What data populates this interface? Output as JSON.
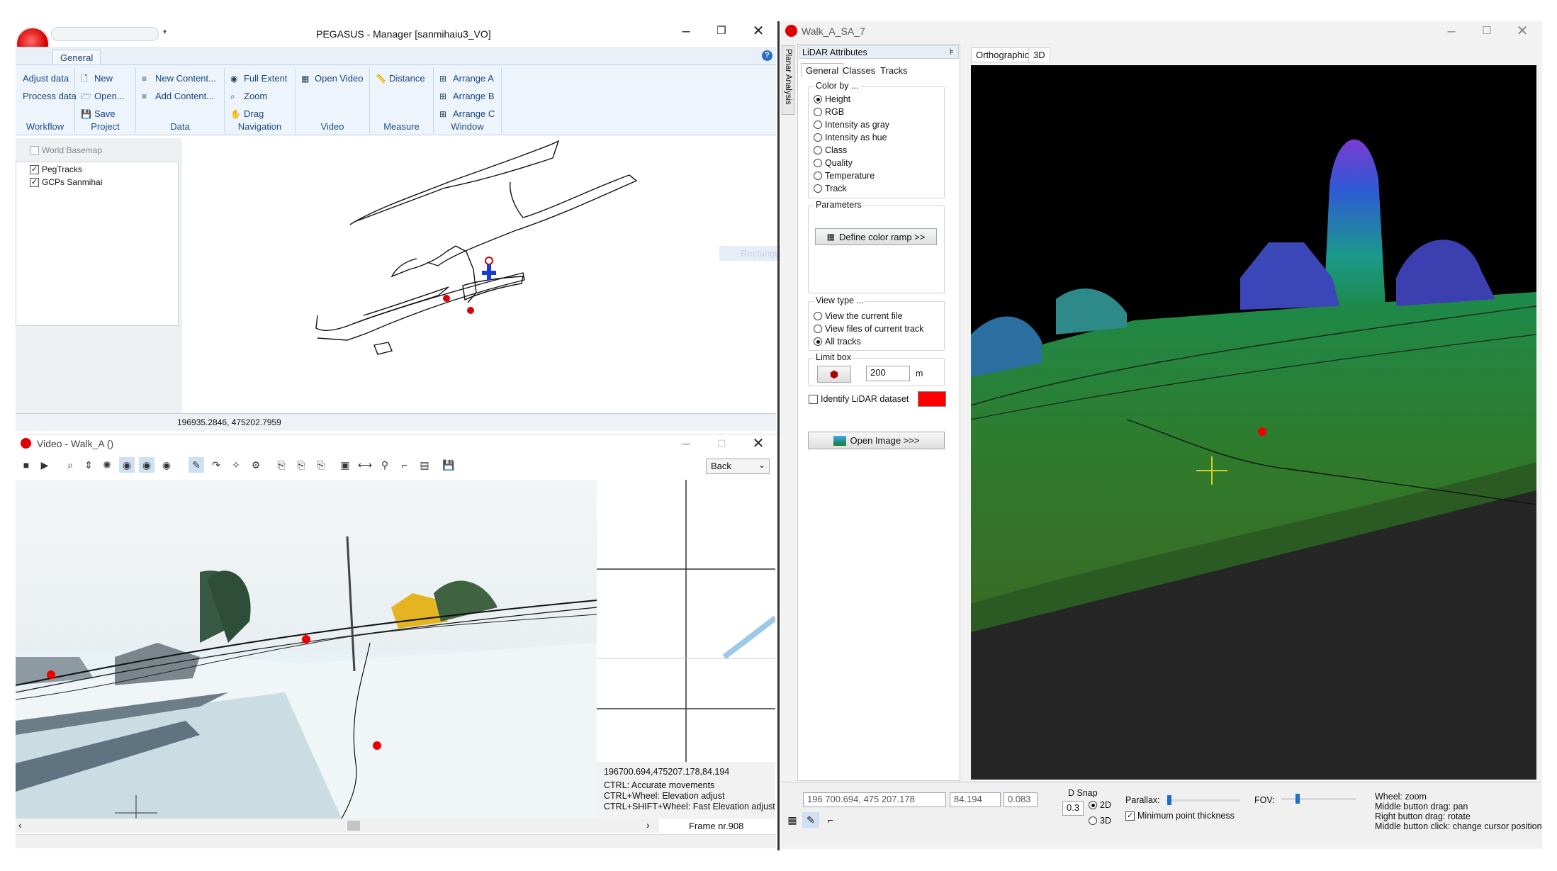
{
  "manager": {
    "title": "PEGASUS - Manager [sanmihaiu3_VO]",
    "tab_general": "General",
    "help": "?",
    "groups": {
      "workflow": {
        "label": "Workflow",
        "items": [
          "Adjust data",
          "Process data"
        ]
      },
      "project": {
        "label": "Project",
        "items": [
          "New",
          "Open...",
          "Save"
        ]
      },
      "data": {
        "label": "Data",
        "items": [
          "New Content...",
          "Add Content..."
        ]
      },
      "navigation": {
        "label": "Navigation",
        "items": [
          "Full Extent",
          "Zoom",
          "Drag"
        ]
      },
      "video": {
        "label": "Video",
        "items": [
          "Open Video"
        ]
      },
      "measure": {
        "label": "Measure",
        "items": [
          "Distance"
        ]
      },
      "window": {
        "label": "Window",
        "items": [
          "Arrange A",
          "Arrange B",
          "Arrange C"
        ]
      }
    },
    "layers": {
      "basemap": "World Basemap",
      "items": [
        "PegTracks",
        "GCPs Sanmihai"
      ]
    },
    "map_tooltip": "Rectangular Info",
    "status_coords": "196935.2846, 475202.7959"
  },
  "video": {
    "title": "Video - Walk_A ()",
    "direction_select": "Back",
    "coords": "196700.694,475207.178,84.194",
    "hints": [
      "CTRL: Accurate movements",
      "CTRL+Wheel: Elevation adjust",
      "CTRL+SHIFT+Wheel: Fast Elevation adjust"
    ],
    "frame": "Frame nr.908"
  },
  "lidar": {
    "title": "Walk_A_SA_7",
    "side_tab": "Planar Analysis",
    "panel_title": "LiDAR Attributes",
    "tabs": [
      "General",
      "Classes",
      "Tracks"
    ],
    "color_by_label": "Color by ...",
    "color_by": [
      "Height",
      "RGB",
      "Intensity as gray",
      "Intensity as hue",
      "Class",
      "Quality",
      "Temperature",
      "Track"
    ],
    "color_by_selected": "Height",
    "parameters_label": "Parameters",
    "define_ramp": "Define color ramp >>",
    "view_type_label": "View type ...",
    "view_types": [
      "View the current file",
      "View files of current track",
      "All tracks"
    ],
    "view_type_selected": "All tracks",
    "limit_box_label": "Limit box",
    "limit_value": "200",
    "limit_unit": "m",
    "identify_label": "Identify LiDAR dataset",
    "identify_color": "#ff0000",
    "open_image": "Open Image >>>",
    "view_tabs": [
      "Orthographic",
      "3D"
    ],
    "bottom": {
      "coords": "196 700.694,  475 207.178",
      "elevation": "84.194",
      "value2": "0.083",
      "dsnap_label": "D Snap",
      "dsnap_value": "0.3",
      "opt_2d": "2D",
      "opt_3d": "3D",
      "parallax_label": "Parallax:",
      "fov_label": "FOV:",
      "min_point": "Minimum point thickness",
      "help": [
        "Wheel: zoom",
        "Middle button drag: pan",
        "Right button drag: rotate",
        "Middle button click: change cursor position"
      ]
    }
  }
}
